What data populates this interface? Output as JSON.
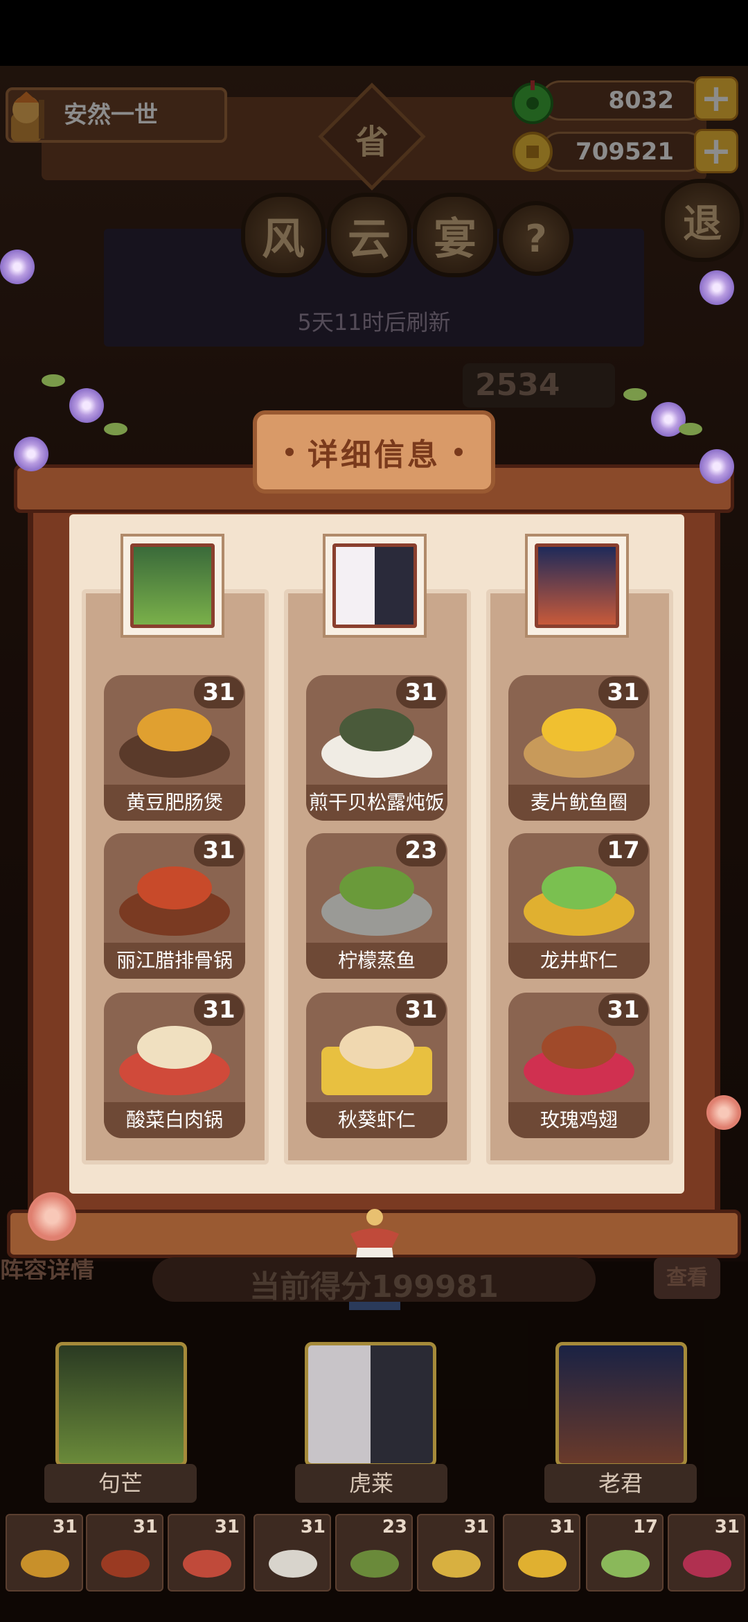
{
  "player": {
    "name": "安然一世"
  },
  "currency": {
    "jade": "8032",
    "coins": "709521",
    "add": "+"
  },
  "event": {
    "badge": "省",
    "title_chars": [
      "风",
      "云",
      "宴"
    ],
    "help": "?",
    "exit": "退",
    "refresh": "5天11时后刷新",
    "score_partial": "2534"
  },
  "panel": {
    "title": "详细信息",
    "columns": [
      {
        "dishes": [
          {
            "name": "黄豆肥肠煲",
            "count": "31"
          },
          {
            "name": "丽江腊排骨锅",
            "count": "31"
          },
          {
            "name": "酸菜白肉锅",
            "count": "31"
          }
        ]
      },
      {
        "dishes": [
          {
            "name": "煎干贝松露炖饭",
            "count": "31"
          },
          {
            "name": "柠檬蒸鱼",
            "count": "23"
          },
          {
            "name": "秋葵虾仁",
            "count": "31"
          }
        ]
      },
      {
        "dishes": [
          {
            "name": "麦片鱿鱼圈",
            "count": "31"
          },
          {
            "name": "龙井虾仁",
            "count": "17"
          },
          {
            "name": "玫瑰鸡翅",
            "count": "31"
          }
        ]
      }
    ]
  },
  "bottom": {
    "lineup": "阵容详情",
    "score": "当前得分199981",
    "right_btn": "查看",
    "heroes": [
      "句芒",
      "虎莱",
      "老君"
    ],
    "dish_counts": [
      "31",
      "31",
      "31",
      "31",
      "23",
      "31",
      "31",
      "17",
      "31"
    ]
  },
  "colors": {
    "accent": "#f7c23a",
    "panel": "#7a3a22",
    "card": "#8a6450"
  }
}
